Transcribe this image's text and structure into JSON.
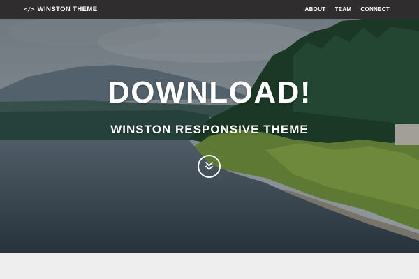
{
  "navbar": {
    "brand_icon": "</>",
    "brand_text": "WINSTON THEME",
    "links": [
      {
        "label": "ABOUT"
      },
      {
        "label": "TEAM"
      },
      {
        "label": "CONNECT"
      }
    ]
  },
  "hero": {
    "headline": "DOWNLOAD!",
    "subheadline": "WINSTON RESPONSIVE THEME",
    "scroll_icon": "double-chevron-down-icon"
  },
  "colors": {
    "navbar_bg": "#2f2d2d",
    "text": "#ffffff",
    "page_bg": "#eeeeee"
  }
}
